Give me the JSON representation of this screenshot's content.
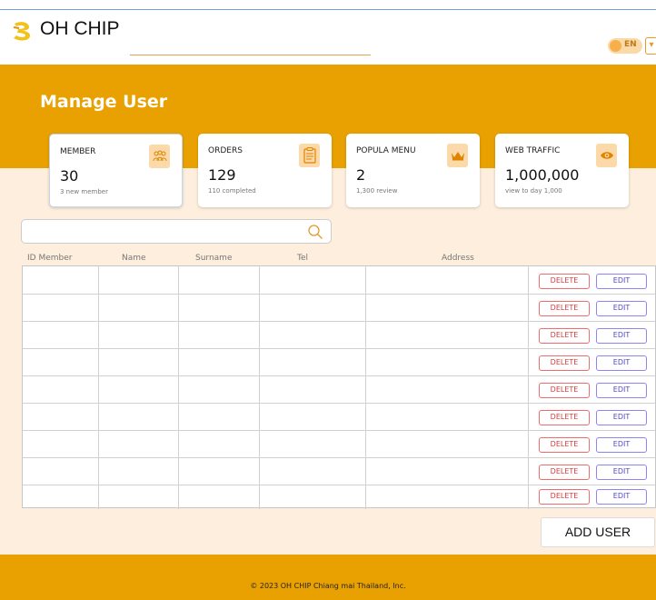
{
  "header": {
    "brand": "OH CHIP",
    "language": "EN",
    "menu_glyph": "▾"
  },
  "page": {
    "title": "Manage User"
  },
  "stats": [
    {
      "title": "MEMBER",
      "value": "30",
      "sub": "3 new member",
      "icon": "members-icon"
    },
    {
      "title": "ORDERS",
      "value": "129",
      "sub": "110 completed",
      "icon": "clipboard-icon"
    },
    {
      "title": "POPULA MENU",
      "value": "2",
      "sub": "1,300 review",
      "icon": "crown-icon"
    },
    {
      "title": "WEB TRAFFIC",
      "value": "1,000,000",
      "sub": "view to day 1,000",
      "icon": "eye-icon"
    }
  ],
  "search": {
    "placeholder": "",
    "value": ""
  },
  "table": {
    "columns": [
      "ID Member",
      "Name",
      "Surname",
      "Tel",
      "Address"
    ],
    "rows": [
      {
        "id": "",
        "name": "",
        "surname": "",
        "tel": "",
        "address": ""
      },
      {
        "id": "",
        "name": "",
        "surname": "",
        "tel": "",
        "address": ""
      },
      {
        "id": "",
        "name": "",
        "surname": "",
        "tel": "",
        "address": ""
      },
      {
        "id": "",
        "name": "",
        "surname": "",
        "tel": "",
        "address": ""
      },
      {
        "id": "",
        "name": "",
        "surname": "",
        "tel": "",
        "address": ""
      },
      {
        "id": "",
        "name": "",
        "surname": "",
        "tel": "",
        "address": ""
      },
      {
        "id": "",
        "name": "",
        "surname": "",
        "tel": "",
        "address": ""
      },
      {
        "id": "",
        "name": "",
        "surname": "",
        "tel": "",
        "address": ""
      },
      {
        "id": "",
        "name": "",
        "surname": "",
        "tel": "",
        "address": ""
      }
    ],
    "delete_label": "DELETE",
    "edit_label": "EDIT"
  },
  "actions": {
    "add_user_label": "ADD USER"
  },
  "footer": {
    "text": "© 2023 OH CHIP Chiang mai Thailand, Inc."
  },
  "colors": {
    "brand_orange": "#e8a100",
    "peach": "#fdeedd",
    "delete": "#ee6c6c",
    "edit": "#8e85ee"
  }
}
